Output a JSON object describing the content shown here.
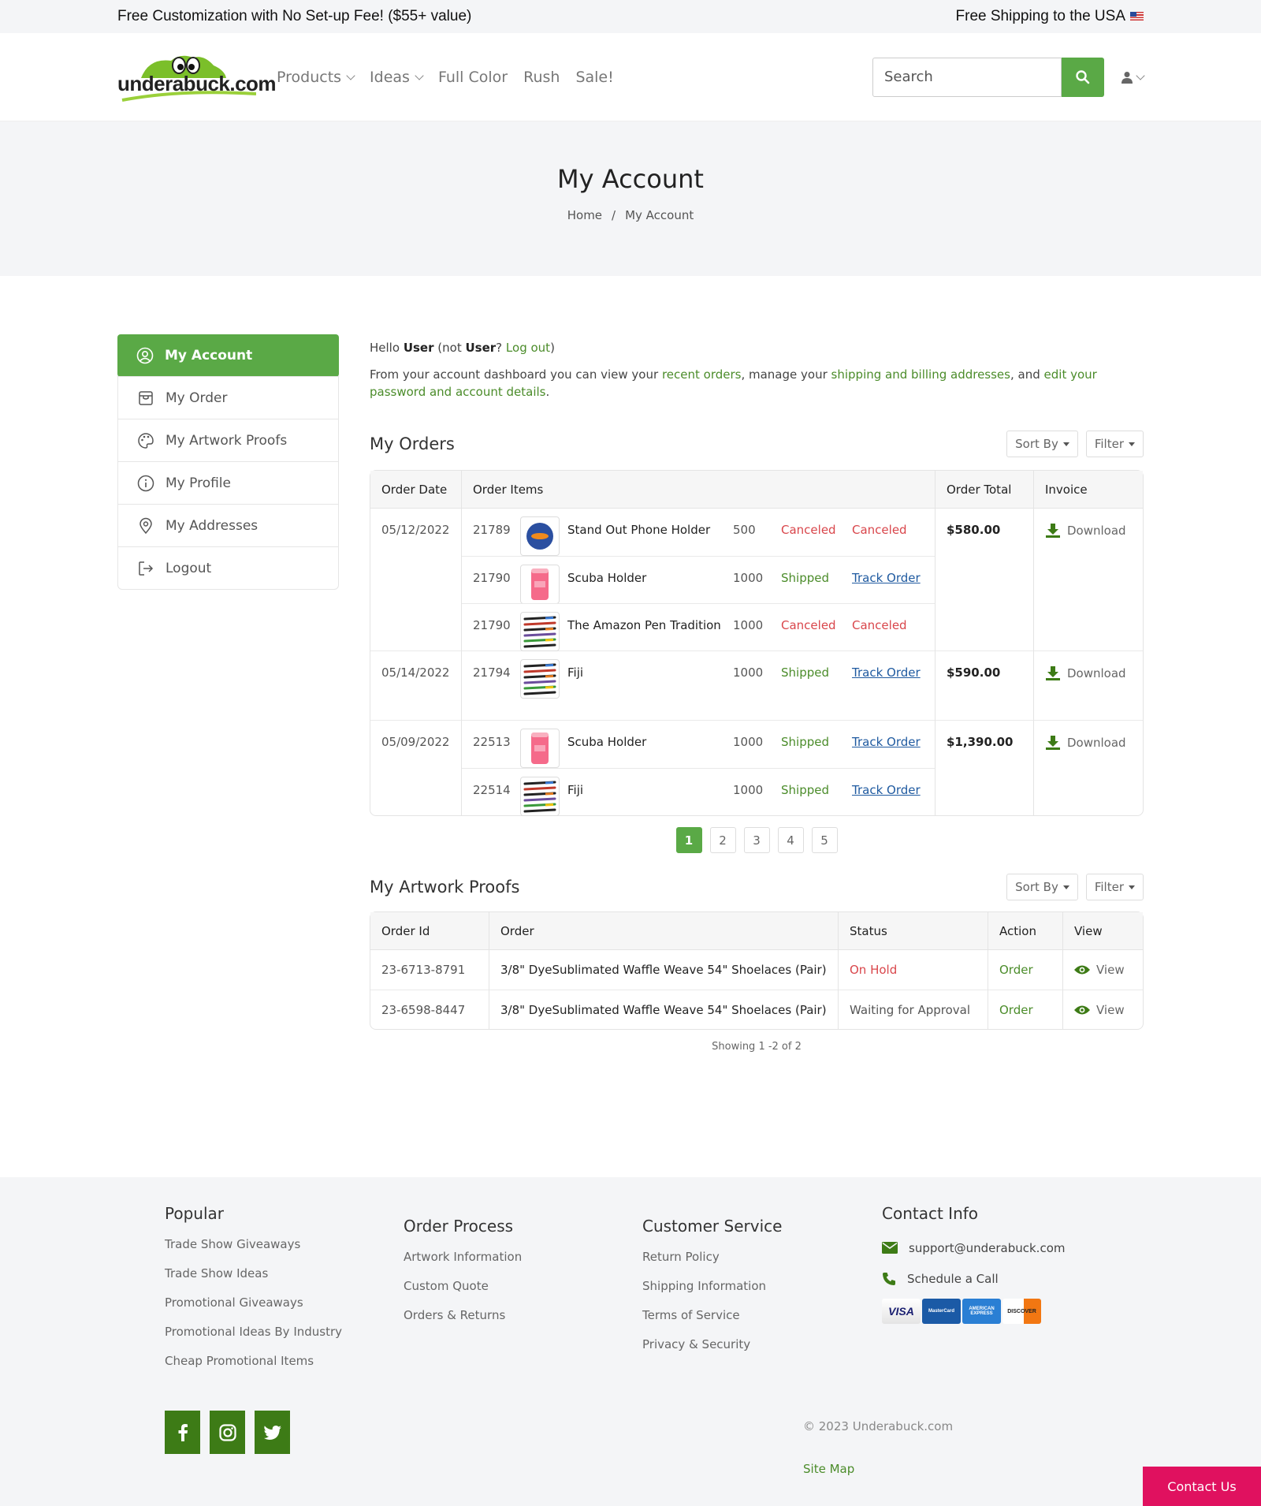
{
  "topbar": {
    "left_text": "Free Customization with No Set-up Fee! ($55+ value)",
    "right_text": "Free Shipping to the USA"
  },
  "header": {
    "logo_text": "underabuck.com",
    "nav": [
      {
        "label": "Products",
        "has_dropdown": true
      },
      {
        "label": "Ideas",
        "has_dropdown": true
      },
      {
        "label": "Full Color",
        "has_dropdown": false
      },
      {
        "label": "Rush",
        "has_dropdown": false
      },
      {
        "label": "Sale!",
        "has_dropdown": false
      }
    ],
    "search_placeholder": "Search"
  },
  "banner": {
    "title": "My Account",
    "breadcrumb": [
      "Home",
      "My Account"
    ],
    "separator": "/"
  },
  "sidebar": {
    "items": [
      {
        "label": "My Account",
        "icon": "user-circle-icon",
        "active": true
      },
      {
        "label": "My Order",
        "icon": "shopping-bag-icon",
        "active": false
      },
      {
        "label": "My Artwork Proofs",
        "icon": "palette-icon",
        "active": false
      },
      {
        "label": "My Profile",
        "icon": "info-circle-icon",
        "active": false
      },
      {
        "label": "My Addresses",
        "icon": "map-pin-icon",
        "active": false
      },
      {
        "label": "Logout",
        "icon": "logout-icon",
        "active": false
      }
    ]
  },
  "greeting": {
    "hello": "Hello",
    "user": "User",
    "not_prefix": "(not",
    "user2": "User",
    "question": "?",
    "logout": "Log out",
    "close": ")",
    "intro_1": "From your account dashboard you can view your",
    "link_orders": "recent orders",
    "intro_2": ", manage your",
    "link_addresses": "shipping and billing addresses",
    "intro_3": ", and",
    "link_password": "edit your password and account details",
    "intro_4": "."
  },
  "orders": {
    "title": "My Orders",
    "sort_label": "Sort By",
    "filter_label": "Filter",
    "columns": [
      "Order Date",
      "Order Items",
      "Order Total",
      "Invoice"
    ],
    "download_label": "Download",
    "rows": [
      {
        "date": "05/12/2022",
        "total": "$580.00",
        "items": [
          {
            "id": "21789",
            "name": "Stand Out Phone Holder",
            "qty": "500",
            "status": "Canceled",
            "action": "Canceled",
            "thumb": "phone-holder-thumb"
          },
          {
            "id": "21790",
            "name": "Scuba Holder",
            "qty": "1000",
            "status": "Shipped",
            "action": "Track Order",
            "thumb": "scuba-holder-thumb"
          },
          {
            "id": "21790",
            "name": "The Amazon Pen Tradition",
            "qty": "1000",
            "status": "Canceled",
            "action": "Canceled",
            "thumb": "pens-thumb"
          }
        ]
      },
      {
        "date": "05/14/2022",
        "total": "$590.00",
        "items": [
          {
            "id": "21794",
            "name": "Fiji",
            "qty": "1000",
            "status": "Shipped",
            "action": "Track Order",
            "thumb": "pens-thumb"
          }
        ]
      },
      {
        "date": "05/09/2022",
        "total": "$1,390.00",
        "items": [
          {
            "id": "22513",
            "name": "Scuba Holder",
            "qty": "1000",
            "status": "Shipped",
            "action": "Track Order",
            "thumb": "scuba-holder-thumb"
          },
          {
            "id": "22514",
            "name": "Fiji",
            "qty": "1000",
            "status": "Shipped",
            "action": "Track Order",
            "thumb": "pens-thumb"
          }
        ]
      }
    ],
    "pages": [
      "1",
      "2",
      "3",
      "4",
      "5"
    ],
    "current_page": "1"
  },
  "proofs": {
    "title": "My Artwork Proofs",
    "sort_label": "Sort By",
    "filter_label": "Filter",
    "columns": [
      "Order Id",
      "Order",
      "Status",
      "Action",
      "View"
    ],
    "rows": [
      {
        "id": "23-6713-8791",
        "order": "3/8\" DyeSublimated Waffle Weave 54\" Shoelaces (Pair)",
        "status": "On Hold",
        "action": "Order",
        "view": "View"
      },
      {
        "id": "23-6598-8447",
        "order": "3/8\" DyeSublimated Waffle Weave 54\" Shoelaces (Pair)",
        "status": "Waiting for Approval",
        "action": "Order",
        "view": "View"
      }
    ],
    "showing": "Showing 1 -2 of 2"
  },
  "footer": {
    "popular": {
      "title": "Popular",
      "links": [
        "Trade Show Giveaways",
        "Trade Show Ideas",
        "Promotional Giveaways",
        "Promotional Ideas By Industry",
        "Cheap Promotional Items"
      ]
    },
    "order_process": {
      "title": "Order Process",
      "links": [
        "Artwork Information",
        "Custom Quote",
        "Orders & Returns"
      ]
    },
    "customer_service": {
      "title": "Customer Service",
      "links": [
        "Return Policy",
        "Shipping Information",
        "Terms of Service",
        "Privacy & Security"
      ]
    },
    "contact": {
      "title": "Contact Info",
      "email": "support@underabuck.com",
      "call": "Schedule a Call"
    },
    "cards": [
      "VISA",
      "MasterCard",
      "AMERICAN EXPRESS",
      "DISCOVER"
    ],
    "copyright": "© 2023 Underabuck.com",
    "sitemap": "Site Map",
    "contact_button": "Contact Us"
  },
  "colors": {
    "accent": "#5aa946",
    "link_green": "#4b8c2a",
    "danger": "#d9464b",
    "track_link": "#1f5aa0",
    "contact_button": "#e0115f"
  }
}
